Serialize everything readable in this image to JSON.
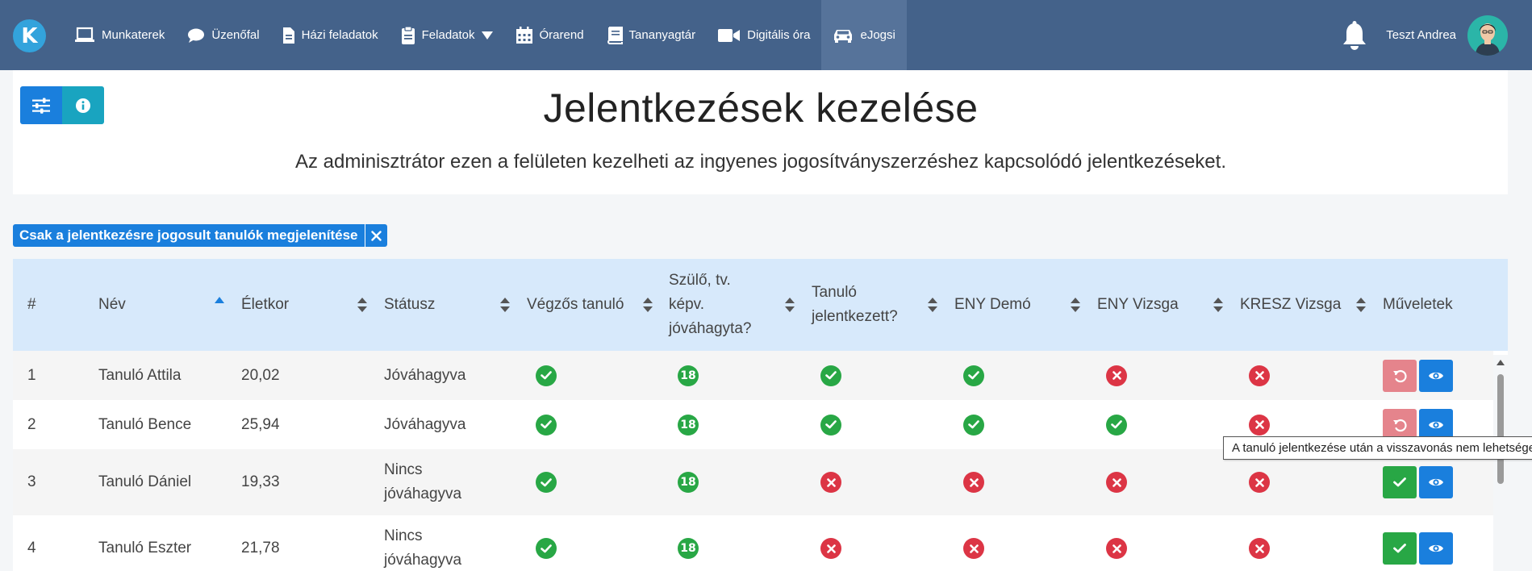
{
  "nav": {
    "logo_letter": "K",
    "items": [
      {
        "label": "Munkaterek",
        "icon": "laptop-icon"
      },
      {
        "label": "Üzenőfal",
        "icon": "chat-bubble-icon"
      },
      {
        "label": "Házi feladatok",
        "icon": "document-icon"
      },
      {
        "label": "Feladatok",
        "icon": "clipboard-icon"
      },
      {
        "label": "Órarend",
        "icon": "calendar-icon"
      },
      {
        "label": "Tananyagtár",
        "icon": "book-icon"
      },
      {
        "label": "Digitális óra",
        "icon": "video-camera-icon"
      },
      {
        "label": "eJogsi",
        "icon": "car-icon",
        "active": true
      }
    ],
    "user_name": "Teszt Andrea"
  },
  "header": {
    "title": "Jelentkezések kezelése",
    "subtitle": "Az adminisztrátor ezen a felületen kezelheti az ingyenes jogosítványszerzéshez kapcsolódó jelentkezéseket."
  },
  "filter_chip": {
    "label": "Csak a jelentkezésre jogosult tanulók megjelenítése"
  },
  "table": {
    "columns": [
      {
        "label": "#"
      },
      {
        "label": "Név",
        "sort": "asc"
      },
      {
        "label": "Életkor",
        "sort": "both"
      },
      {
        "label": "Státusz",
        "sort": "both"
      },
      {
        "label": "Végzős tanuló",
        "sort": "both"
      },
      {
        "label_lines": [
          "Szülő, tv.",
          "képv.",
          "jóváhagyta?"
        ],
        "sort": "both"
      },
      {
        "label_lines": [
          "Tanuló",
          "jelentkezett?"
        ],
        "sort": "both"
      },
      {
        "label": "ENY Demó",
        "sort": "both"
      },
      {
        "label": "ENY Vizsga",
        "sort": "both"
      },
      {
        "label": "KRESZ Vizsga",
        "sort": "both"
      },
      {
        "label": "Műveletek"
      }
    ],
    "rows": [
      {
        "num": "1",
        "name": "Tanuló Attila",
        "age": "20,02",
        "status_lines": [
          "Jóváhagyva"
        ],
        "vegzos": "ok",
        "szulo": "18",
        "jelentkezett": "ok",
        "eny_demo": "ok",
        "eny_vizsga": "no",
        "kresz": "no",
        "actions": [
          "undo",
          "view"
        ]
      },
      {
        "num": "2",
        "name": "Tanuló Bence",
        "age": "25,94",
        "status_lines": [
          "Jóváhagyva"
        ],
        "vegzos": "ok",
        "szulo": "18",
        "jelentkezett": "ok",
        "eny_demo": "ok",
        "eny_vizsga": "ok",
        "kresz": "no",
        "actions": [
          "undo",
          "view"
        ]
      },
      {
        "num": "3",
        "name": "Tanuló Dániel",
        "age": "19,33",
        "status_lines": [
          "Nincs",
          "jóváhagyva"
        ],
        "vegzos": "ok",
        "szulo": "18",
        "jelentkezett": "no",
        "eny_demo": "no",
        "eny_vizsga": "no",
        "kresz": "no",
        "actions": [
          "approve",
          "view"
        ]
      },
      {
        "num": "4",
        "name": "Tanuló Eszter",
        "age": "21,78",
        "status_lines": [
          "Nincs",
          "jóváhagyva"
        ],
        "vegzos": "ok",
        "szulo": "18",
        "jelentkezett": "no",
        "eny_demo": "no",
        "eny_vizsga": "no",
        "kresz": "no",
        "actions": [
          "approve",
          "view"
        ]
      }
    ]
  },
  "tooltip": {
    "text": "A tanuló jelentkezése után a visszavonás nem lehetséges"
  },
  "colors": {
    "navbar": "#44628a",
    "primary": "#1a7fdd",
    "success": "#28a745",
    "danger": "#dc3545",
    "table_header": "#d7e9fb"
  }
}
